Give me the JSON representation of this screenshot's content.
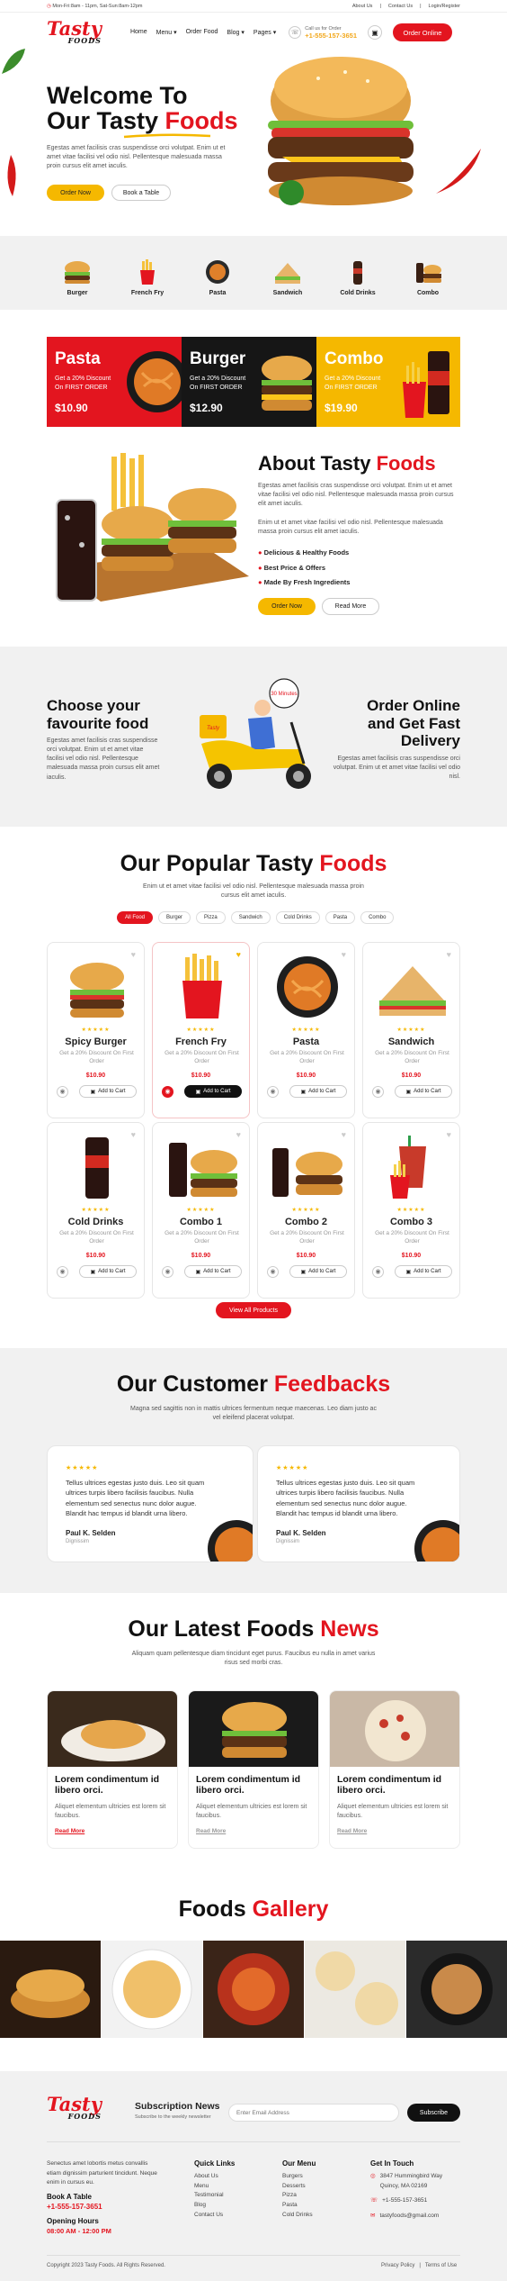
{
  "topbar": {
    "hours": "Mon-Fri:8am - 11pm, Sat-Sun:8am-12pm",
    "links": [
      "About Us",
      "Contact Us",
      "Login/Register"
    ]
  },
  "brand": {
    "name": "Tasty",
    "sub": "FOODS"
  },
  "nav": {
    "items": [
      "Home",
      "Menu",
      "Order Food",
      "Blog",
      "Pages"
    ],
    "call_label": "Call us for Order",
    "phone": "+1-555-157-3651",
    "order_btn": "Order Online"
  },
  "hero": {
    "title_1": "Welcome To",
    "title_2": "Our Tasty",
    "title_3": "Foods",
    "desc": "Egestas amet facilisis cras suspendisse orci volutpat. Enim ut et amet vitae facilisi vel odio nisl. Pellentesque malesuada massa proin cursus elit amet iaculis.",
    "btn_order": "Order Now",
    "btn_table": "Book a Table"
  },
  "categories": [
    "Burger",
    "French Fry",
    "Pasta",
    "Sandwich",
    "Cold Drinks",
    "Combo"
  ],
  "promos": [
    {
      "title": "Pasta",
      "line1": "Get a 20% Discount",
      "line2": "On FIRST ORDER",
      "price": "$10.90",
      "bg": "#e3151f"
    },
    {
      "title": "Burger",
      "line1": "Get a 20% Discount",
      "line2": "On FIRST ORDER",
      "price": "$12.90",
      "bg": "#161616"
    },
    {
      "title": "Combo",
      "line1": "Get a 20% Discount",
      "line2": "On FIRST ORDER",
      "price": "$19.90",
      "bg": "#f5b800"
    }
  ],
  "about": {
    "title_1": "About Tasty",
    "title_2": "Foods",
    "p1": "Egestas amet facilisis cras suspendisse orci volutpat. Enim ut et amet vitae facilisi vel odio nisl. Pellentesque malesuada massa proin cursus elit amet iaculis.",
    "p2": "Enim ut et amet vitae facilisi vel odio nisl. Pellentesque malesuada massa proin cursus elit amet iaculis.",
    "features": [
      "Delicious & Healthy Foods",
      "Best Price & Offers",
      "Made By Fresh Ingredients"
    ],
    "btn_order": "Order Now",
    "btn_more": "Read More"
  },
  "delivery": {
    "left_title": "Choose your favourite food",
    "left_desc": "Egestas amet facilisis cras suspendisse orci volutpat. Enim ut et amet vitae facilisi vel odio nisl. Pellentesque malesuada massa proin cursus elit amet iaculis.",
    "badge": "30 Minutes",
    "scooter_brand": "Tasty",
    "right_title": "Order Online and Get Fast Delivery",
    "right_desc": "Egestas amet facilisis cras suspendisse orci volutpat. Enim ut et amet vitae facilisi vel odio nisl."
  },
  "popular": {
    "title_1": "Our Popular Tasty",
    "title_2": "Foods",
    "desc": "Enim ut et amet vitae facilisi vel odio nisl. Pellentesque malesuada massa proin cursus elit amet iaculis.",
    "filters": [
      "All Food",
      "Burger",
      "Pizza",
      "Sandwich",
      "Cold Drinks",
      "Pasta",
      "Combo"
    ],
    "items": [
      {
        "name": "Spicy Burger",
        "desc": "Get a 20% Discount On First Order",
        "price": "$10.90",
        "stars": "★★★★★"
      },
      {
        "name": "French Fry",
        "desc": "Get a 20% Discount On First Order",
        "price": "$10.90",
        "stars": "★★★★★"
      },
      {
        "name": "Pasta",
        "desc": "Get a 20% Discount On First Order",
        "price": "$10.90",
        "stars": "★★★★★"
      },
      {
        "name": "Sandwich",
        "desc": "Get a 20% Discount On First Order",
        "price": "$10.90",
        "stars": "★★★★★"
      },
      {
        "name": "Cold Drinks",
        "desc": "Get a 20% Discount On First Order",
        "price": "$10.90",
        "stars": "★★★★★"
      },
      {
        "name": "Combo 1",
        "desc": "Get a 20% Discount On First Order",
        "price": "$10.90",
        "stars": "★★★★★"
      },
      {
        "name": "Combo 2",
        "desc": "Get a 20% Discount On First Order",
        "price": "$10.90",
        "stars": "★★★★★"
      },
      {
        "name": "Combo 3",
        "desc": "Get a 20% Discount On First Order",
        "price": "$10.90",
        "stars": "★★★★★"
      }
    ],
    "add_label": "Add to Cart",
    "view_all": "View All Products"
  },
  "feedback": {
    "title_1": "Our Customer",
    "title_2": "Feedbacks",
    "desc": "Magna sed sagittis non in mattis ultrices fermentum neque maecenas. Leo diam justo ac vel eleifend placerat volutpat.",
    "items": [
      {
        "stars": "★★★★★",
        "quote": "Tellus ultrices egestas justo duis. Leo sit quam ultrices turpis libero facilisis faucibus. Nulla elementum sed senectus nunc dolor augue. Blandit hac tempus id blandit urna libero.",
        "name": "Paul K. Selden",
        "role": "Dignissim"
      },
      {
        "stars": "★★★★★",
        "quote": "Tellus ultrices egestas justo duis. Leo sit quam ultrices turpis libero facilisis faucibus. Nulla elementum sed senectus nunc dolor augue. Blandit hac tempus id blandit urna libero.",
        "name": "Paul K. Selden",
        "role": "Dignissim"
      }
    ]
  },
  "news": {
    "title_1": "Our Latest Foods",
    "title_2": "News",
    "desc": "Aliquam quam pellentesque diam tincidunt eget purus. Faucibus eu nulla in amet varius risus sed morbi cras.",
    "items": [
      {
        "title": "Lorem condimentum id libero orci.",
        "desc": "Aliquet elementum ultricies est lorem sit faucibus.",
        "more": "Read More"
      },
      {
        "title": "Lorem condimentum id libero orci.",
        "desc": "Aliquet elementum ultricies est lorem sit faucibus.",
        "more": "Read More"
      },
      {
        "title": "Lorem condimentum id libero orci.",
        "desc": "Aliquet elementum ultricies est lorem sit faucibus.",
        "more": "Read More"
      }
    ]
  },
  "gallery": {
    "title_1": "Foods",
    "title_2": "Gallery"
  },
  "footer": {
    "sub_title": "Subscription News",
    "sub_desc": "Subscribe to the weekly newsletter",
    "email_placeholder": "Enter Email Address",
    "sub_btn": "Subscribe",
    "about": "Senectus amet lobortis metus convallis etiam dignissim parturient tincidunt. Neque enim in cursus eu.",
    "book_label": "Book A Table",
    "book_phone": "+1-555-157-3651",
    "hours_label": "Opening Hours",
    "hours": "08:00 AM - 12:00 PM",
    "quick_title": "Quick Links",
    "quick": [
      "About Us",
      "Menu",
      "Testimonial",
      "Blog",
      "Contact Us"
    ],
    "menu_title": "Our Menu",
    "menu": [
      "Burgers",
      "Desserts",
      "Pizza",
      "Pasta",
      "Cold Drinks"
    ],
    "touch_title": "Get In Touch",
    "address": "3847 Hummingbird Way Quincy, MA 02169",
    "phone": "+1-555-157-3651",
    "email": "tastyfoods@gmail.com",
    "copyright": "Copyright 2023 Tasty Foods. All Rights Reserved.",
    "legal": [
      "Privacy Policy",
      "Terms of Use"
    ]
  }
}
